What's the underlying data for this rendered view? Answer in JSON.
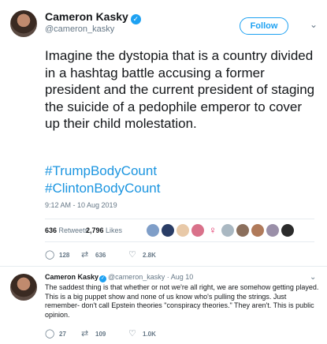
{
  "tweet": {
    "name": "Cameron Kasky",
    "handle": "@cameron_kasky",
    "follow_label": "Follow",
    "text": "Imagine the dystopia that is a country divided in a hashtag battle accusing a former president and the current president of staging the suicide of a pedophile emperor to cover up their child molestation.",
    "hashtags": [
      "#TrumpBodyCount",
      "#ClintonBodyCount"
    ],
    "timestamp": "9:12 AM - 10 Aug 2019",
    "retweets_count": "636",
    "retweets_label": "Retweets",
    "likes_count": "2,796",
    "likes_label": "Likes",
    "actions": {
      "replies": "128",
      "retweets": "636",
      "likes": "2.8K"
    }
  },
  "reply": {
    "name": "Cameron Kasky",
    "handle": "@cameron_kasky",
    "date": "· Aug 10",
    "text": "The saddest thing is that whether or not we're all right, we are somehow getting played. This is a big puppet show and none of us know who's pulling the strings. Just remember- don't call Epstein theories \"conspiracy theories.\" They aren't. This is public opinion.",
    "actions": {
      "replies": "27",
      "retweets": "109",
      "likes": "1.0K"
    }
  },
  "colors": {
    "accent": "#1da1f2",
    "link": "#1b95e0",
    "muted": "#657786",
    "text": "#14171a",
    "venus": "#e0245e"
  },
  "icons": [
    "verified-badge-icon",
    "chevron-down-icon",
    "reply-icon",
    "retweet-icon",
    "like-icon"
  ]
}
